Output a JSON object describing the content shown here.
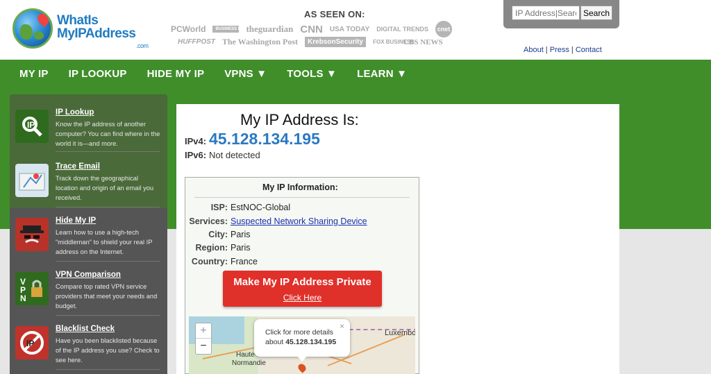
{
  "logo": {
    "line1": "WhatIs",
    "line2": "MyIPAddress",
    "suffix": ".com"
  },
  "as_seen_on": {
    "title": "AS SEEN ON:",
    "row1": [
      "PCWorld",
      "BUSINESS INSIDER",
      "theguardian",
      "CNN",
      "USA TODAY",
      "DIGITAL TRENDS",
      "cnet"
    ],
    "row2": [
      "HUFFPOST",
      "The Washington Post",
      "KrebsonSecurity",
      "FOX BUSINESS",
      "CBS NEWS"
    ]
  },
  "search": {
    "placeholder": "IP Address|Search",
    "button": "Search"
  },
  "top_links": [
    "About",
    "Press",
    "Contact"
  ],
  "nav": [
    "MY IP",
    "IP LOOKUP",
    "HIDE MY IP",
    "VPNS ▼",
    "TOOLS ▼",
    "LEARN ▼"
  ],
  "sidebar": [
    {
      "title": "IP Lookup",
      "desc": "Know the IP address of another computer? You can find where in the world it is—and more.",
      "icon": "magnifier-icon",
      "color": "#2f6b1e"
    },
    {
      "title": "Trace Email",
      "desc": "Track down the geographical location and origin of an email you received.",
      "icon": "map-icon",
      "color": "#d8e6f0"
    },
    {
      "title": "Hide My IP",
      "desc": "Learn how to use a high-tech \"middleman\" to shield your real IP address on the Internet.",
      "icon": "spy-icon",
      "color": "#b8322a"
    },
    {
      "title": "VPN Comparison",
      "desc": "Compare top rated VPN service providers that meet your needs and budget.",
      "icon": "vpn-lock-icon",
      "color": "#2f6b1e"
    },
    {
      "title": "Blacklist Check",
      "desc": "Have you been blacklisted because of the IP address you use? Check to see here.",
      "icon": "blacklist-icon",
      "color": "#c0332a"
    }
  ],
  "main": {
    "heading": "My IP Address Is:",
    "ipv4_label": "IPv4:",
    "ipv4": "45.128.134.195",
    "ipv6_label": "IPv6:",
    "ipv6": "Not detected"
  },
  "info": {
    "title": "My IP Information:",
    "rows": [
      {
        "label": "ISP:",
        "value": "EstNOC-Global"
      },
      {
        "label": "Services:",
        "value": "Suspected Network Sharing Device"
      },
      {
        "label": "City:",
        "value": "Paris"
      },
      {
        "label": "Region:",
        "value": "Paris"
      },
      {
        "label": "Country:",
        "value": "France"
      }
    ]
  },
  "cta": {
    "title": "Make My IP Address Private",
    "link": "Click Here"
  },
  "map": {
    "popup_text": "Click for more details about",
    "popup_ip": "45.128.134.195",
    "close": "×",
    "zoom_in": "+",
    "zoom_out": "−",
    "places": [
      "Luxembourg",
      "Haute-Normandie",
      "Normandie"
    ]
  }
}
